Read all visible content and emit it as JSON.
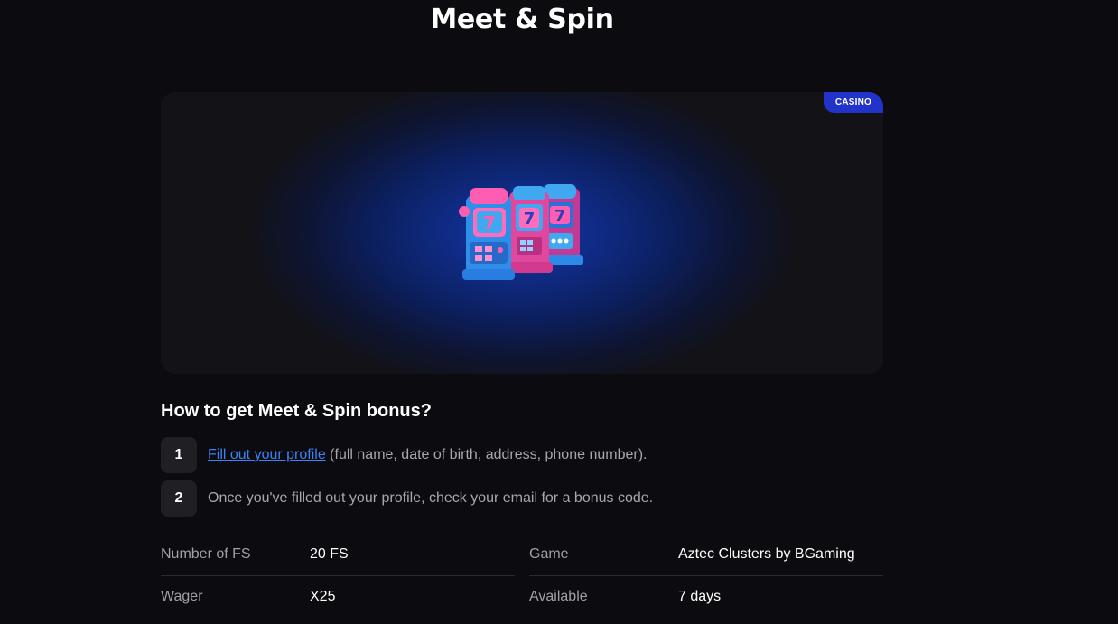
{
  "page": {
    "title": "Meet & Spin"
  },
  "hero": {
    "badge": "CASINO",
    "image_icon": "slot-machines-icon"
  },
  "how_to": {
    "title": "How to get Meet & Spin bonus?",
    "steps": [
      {
        "number": "1",
        "link_text": "Fill out your profile",
        "text": " (full name, date of birth, address, phone number)."
      },
      {
        "number": "2",
        "text": "Once you've filled out your profile, check your email for a bonus code."
      }
    ]
  },
  "details": {
    "number_of_fs": {
      "label": "Number of FS",
      "value": "20 FS"
    },
    "game": {
      "label": "Game",
      "value": "Aztec Clusters by BGaming"
    },
    "wager": {
      "label": "Wager",
      "value": "X25"
    },
    "available": {
      "label": "Available",
      "value": "7 days"
    }
  },
  "colors": {
    "background": "#0c0b0f",
    "badge": "#2233c9",
    "link": "#3b82f6"
  }
}
